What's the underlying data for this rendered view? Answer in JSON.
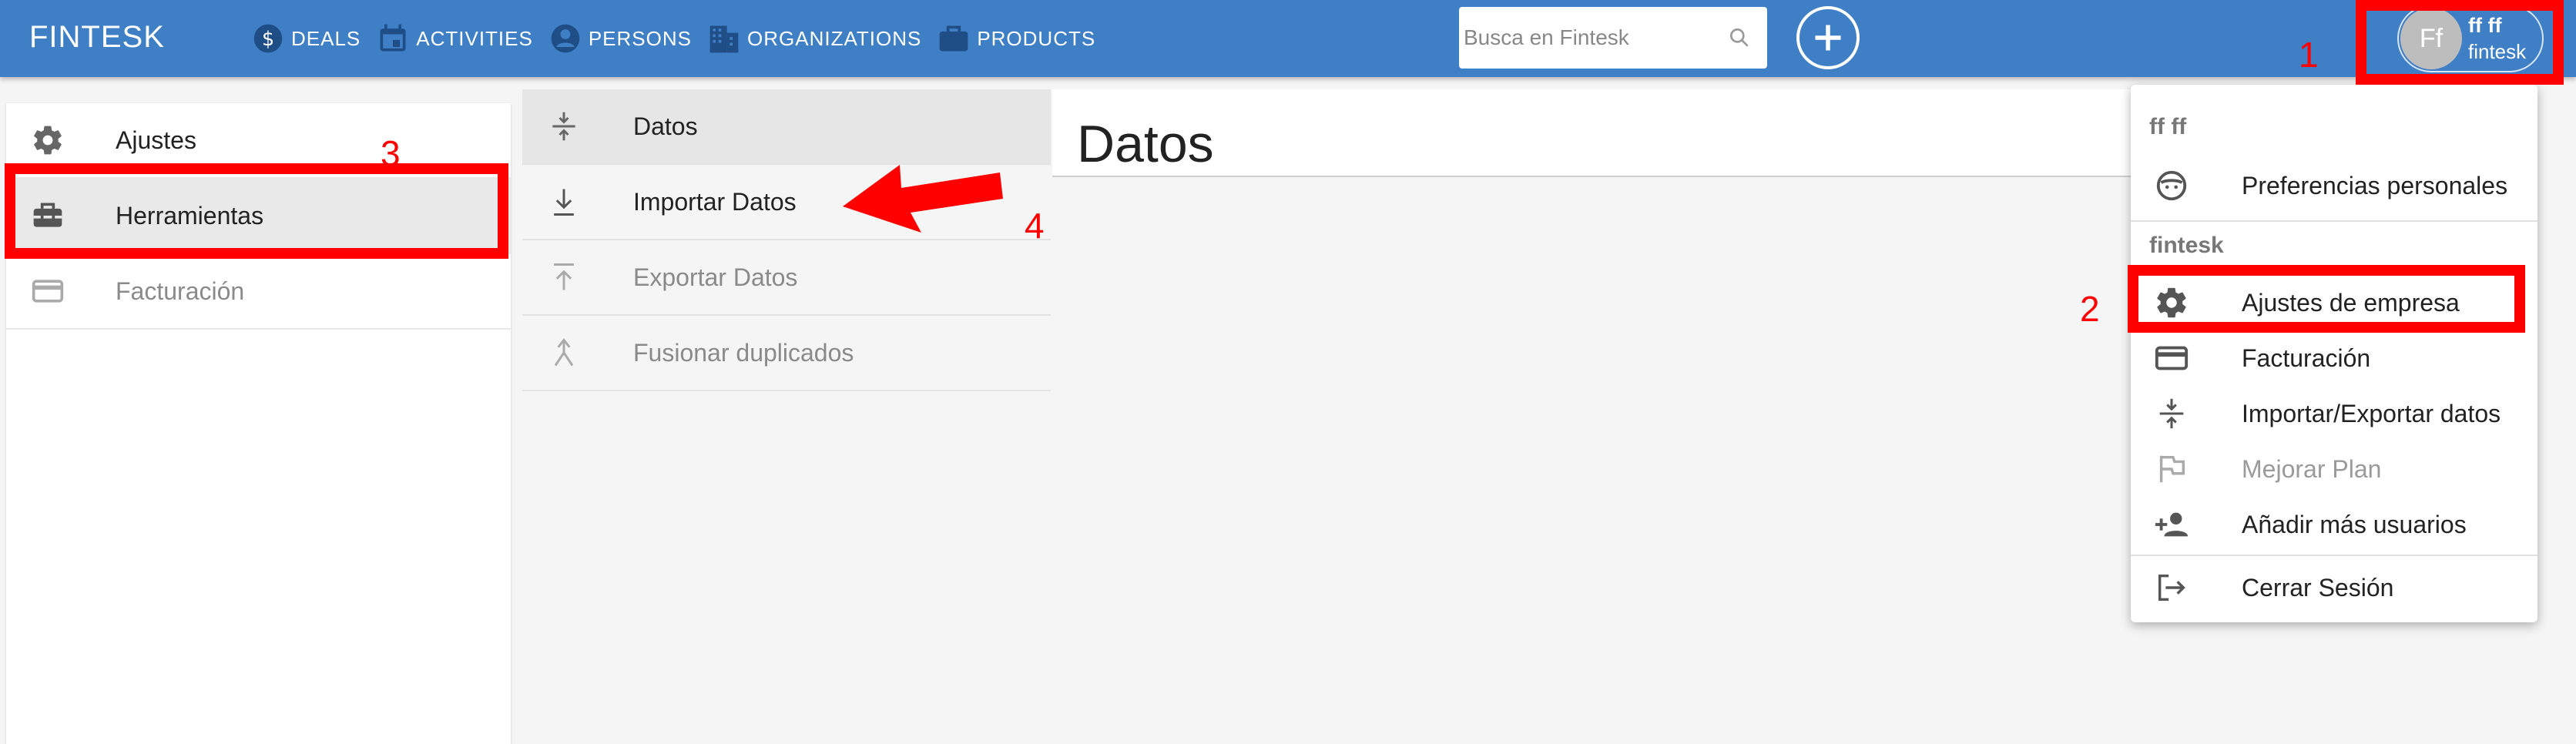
{
  "app": {
    "brand": "FINTESK"
  },
  "nav": [
    {
      "label": "DEALS",
      "icon": "dollar-circle-icon"
    },
    {
      "label": "ACTIVITIES",
      "icon": "calendar-icon"
    },
    {
      "label": "PERSONS",
      "icon": "person-icon"
    },
    {
      "label": "ORGANIZATIONS",
      "icon": "building-icon"
    },
    {
      "label": "PRODUCTS",
      "icon": "briefcase-icon"
    }
  ],
  "search": {
    "placeholder": "Busca en Fintesk",
    "icon": "search-icon"
  },
  "add_button": {
    "icon": "plus-icon"
  },
  "user": {
    "initials": "Ff",
    "name": "ff ff",
    "company": "fintesk"
  },
  "left_menu": [
    {
      "label": "Ajustes",
      "icon": "gear-icon"
    },
    {
      "label": "Herramientas",
      "icon": "toolbox-icon"
    },
    {
      "label": "Facturación",
      "icon": "credit-card-icon"
    }
  ],
  "middle_menu": [
    {
      "label": "Datos",
      "icon": "compress-icon"
    },
    {
      "label": "Importar Datos",
      "icon": "download-icon"
    },
    {
      "label": "Exportar Datos",
      "icon": "upload-icon"
    },
    {
      "label": "Fusionar duplicados",
      "icon": "merge-icon"
    }
  ],
  "content": {
    "title": "Datos"
  },
  "dropdown": {
    "section_user": "ff ff",
    "item_preferences": "Preferencias personales",
    "section_company": "fintesk",
    "item_company_settings": "Ajustes de empresa",
    "item_billing": "Facturación",
    "item_import_export": "Importar/Exportar datos",
    "item_upgrade": "Mejorar Plan",
    "item_add_users": "Añadir más usuarios",
    "item_logout": "Cerrar Sesión"
  },
  "annotations": {
    "n1": "1",
    "n2": "2",
    "n3": "3",
    "n4": "4"
  },
  "colors": {
    "topbar": "#3f7fc6",
    "annotation": "#ff0000"
  }
}
